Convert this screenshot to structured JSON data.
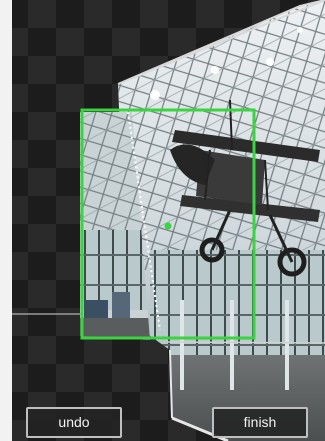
{
  "toolbar": {
    "undo_label": "undo",
    "finish_label": "finish"
  },
  "colors": {
    "frame_guide": "#39d43f",
    "button_border": "#bfbfbf",
    "button_text": "#f2f2f2"
  }
}
